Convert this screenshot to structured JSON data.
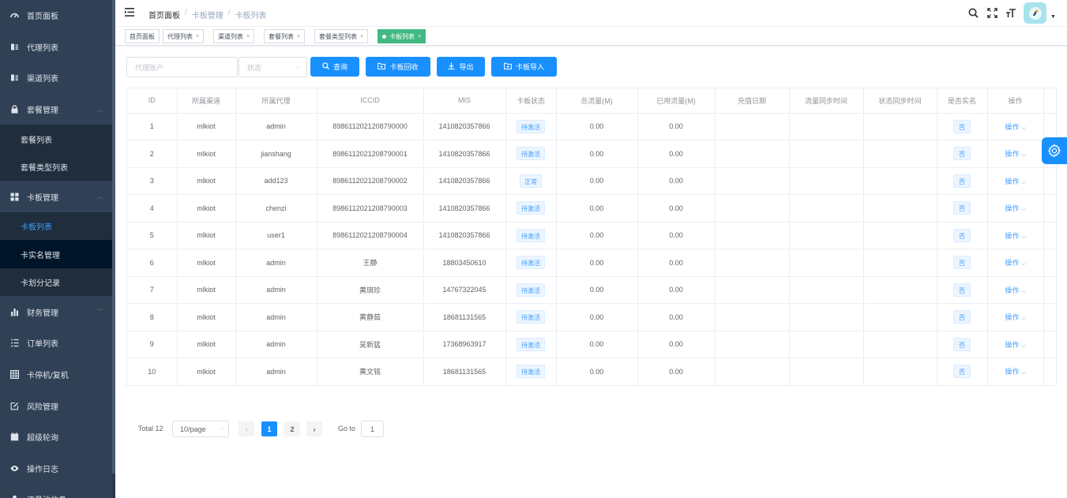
{
  "sidebar": {
    "items": [
      {
        "label": "首页面板",
        "icon": "dashboard-icon"
      },
      {
        "label": "代理列表",
        "icon": "user-card-icon"
      },
      {
        "label": "渠道列表",
        "icon": "user-card-icon"
      },
      {
        "label": "套餐管理",
        "icon": "lock-icon",
        "expanded": true
      },
      {
        "label": "套餐列表",
        "sub": true
      },
      {
        "label": "套餐类型列表",
        "sub": true
      },
      {
        "label": "卡板管理",
        "icon": "grid-icon",
        "expanded": true
      },
      {
        "label": "卡板列表",
        "sub": true,
        "active": true
      },
      {
        "label": "卡实名管理",
        "sub": true
      },
      {
        "label": "卡划分记录",
        "sub": true
      },
      {
        "label": "财务管理",
        "icon": "bar-chart-icon",
        "expanded": false
      },
      {
        "label": "订单列表",
        "icon": "list-icon"
      },
      {
        "label": "卡停机/复机",
        "icon": "table-icon"
      },
      {
        "label": "风险管理",
        "icon": "edit-icon"
      },
      {
        "label": "超级轮询",
        "icon": "calendar-icon"
      },
      {
        "label": "操作日志",
        "icon": "eye-icon"
      },
      {
        "label": "流量池信息",
        "icon": "user-icon"
      }
    ]
  },
  "navbar": {
    "breadcrumb": [
      "首页面板",
      "卡板管理",
      "卡板列表"
    ],
    "separator": "/"
  },
  "tags": [
    {
      "label": "首页面板",
      "closable": false
    },
    {
      "label": "代理列表",
      "closable": true
    },
    {
      "label": "渠道列表",
      "closable": true
    },
    {
      "label": "套餐列表",
      "closable": true
    },
    {
      "label": "套餐类型列表",
      "closable": true
    },
    {
      "label": "卡板列表",
      "closable": true,
      "active": true
    }
  ],
  "filters": {
    "agent_placeholder": "代理账户",
    "status_placeholder": "状态"
  },
  "buttons": {
    "query": "查询",
    "recycle": "卡板回收",
    "export": "导出",
    "import": "卡板导入"
  },
  "table": {
    "columns": [
      "ID",
      "所属渠道",
      "所属代理",
      "ICCID",
      "MIS",
      "卡板状态",
      "总流量(M)",
      "已用流量(M)",
      "充值日期",
      "流量同步时间",
      "状态同步时间",
      "是否实名",
      "操作"
    ],
    "rows": [
      {
        "id": "1",
        "channel": "mlkiot",
        "agent": "admin",
        "iccid": "8986112021208790000",
        "mis": "1410820357866",
        "status": "待激活",
        "total": "0.00",
        "used": "0.00",
        "realname": "否",
        "op": "操作"
      },
      {
        "id": "2",
        "channel": "mlkiot",
        "agent": "jianshang",
        "iccid": "8986112021208790001",
        "mis": "1410820357866",
        "status": "待激活",
        "total": "0.00",
        "used": "0.00",
        "realname": "否",
        "op": "操作"
      },
      {
        "id": "3",
        "channel": "mlkiot",
        "agent": "add123",
        "iccid": "8986112021208790002",
        "mis": "1410820357866",
        "status": "正常",
        "total": "0.00",
        "used": "0.00",
        "realname": "否",
        "op": "操作"
      },
      {
        "id": "4",
        "channel": "mlkiot",
        "agent": "chenzi",
        "iccid": "8986112021208790003",
        "mis": "1410820357866",
        "status": "待激活",
        "total": "0.00",
        "used": "0.00",
        "realname": "否",
        "op": "操作"
      },
      {
        "id": "5",
        "channel": "mlkiot",
        "agent": "user1",
        "iccid": "8986112021208790004",
        "mis": "1410820357866",
        "status": "待激活",
        "total": "0.00",
        "used": "0.00",
        "realname": "否",
        "op": "操作"
      },
      {
        "id": "6",
        "channel": "mlkiot",
        "agent": "admin",
        "iccid": "王静",
        "mis": "18803450610",
        "status": "待激活",
        "total": "0.00",
        "used": "0.00",
        "realname": "否",
        "op": "操作"
      },
      {
        "id": "7",
        "channel": "mlkiot",
        "agent": "admin",
        "iccid": "黄琪珍",
        "mis": "14767322045",
        "status": "待激活",
        "total": "0.00",
        "used": "0.00",
        "realname": "否",
        "op": "操作"
      },
      {
        "id": "8",
        "channel": "mlkiot",
        "agent": "admin",
        "iccid": "黄静茹",
        "mis": "18681131565",
        "status": "待激活",
        "total": "0.00",
        "used": "0.00",
        "realname": "否",
        "op": "操作"
      },
      {
        "id": "9",
        "channel": "mlkiot",
        "agent": "admin",
        "iccid": "吴新猛",
        "mis": "17368963917",
        "status": "待激活",
        "total": "0.00",
        "used": "0.00",
        "realname": "否",
        "op": "操作"
      },
      {
        "id": "10",
        "channel": "mlkiot",
        "agent": "admin",
        "iccid": "黄文铭",
        "mis": "18681131565",
        "status": "待激活",
        "total": "0.00",
        "used": "0.00",
        "realname": "否",
        "op": "操作"
      }
    ]
  },
  "pagination": {
    "total": "Total 12",
    "page_size": "10/page",
    "pages": [
      "1",
      "2"
    ],
    "current": "1",
    "prev": "‹",
    "next": "›",
    "goto_label": "Go to",
    "goto_value": "1"
  },
  "colors": {
    "sidebar_bg": "#304156",
    "primary": "#1890ff",
    "tag_active": "#42b983"
  }
}
